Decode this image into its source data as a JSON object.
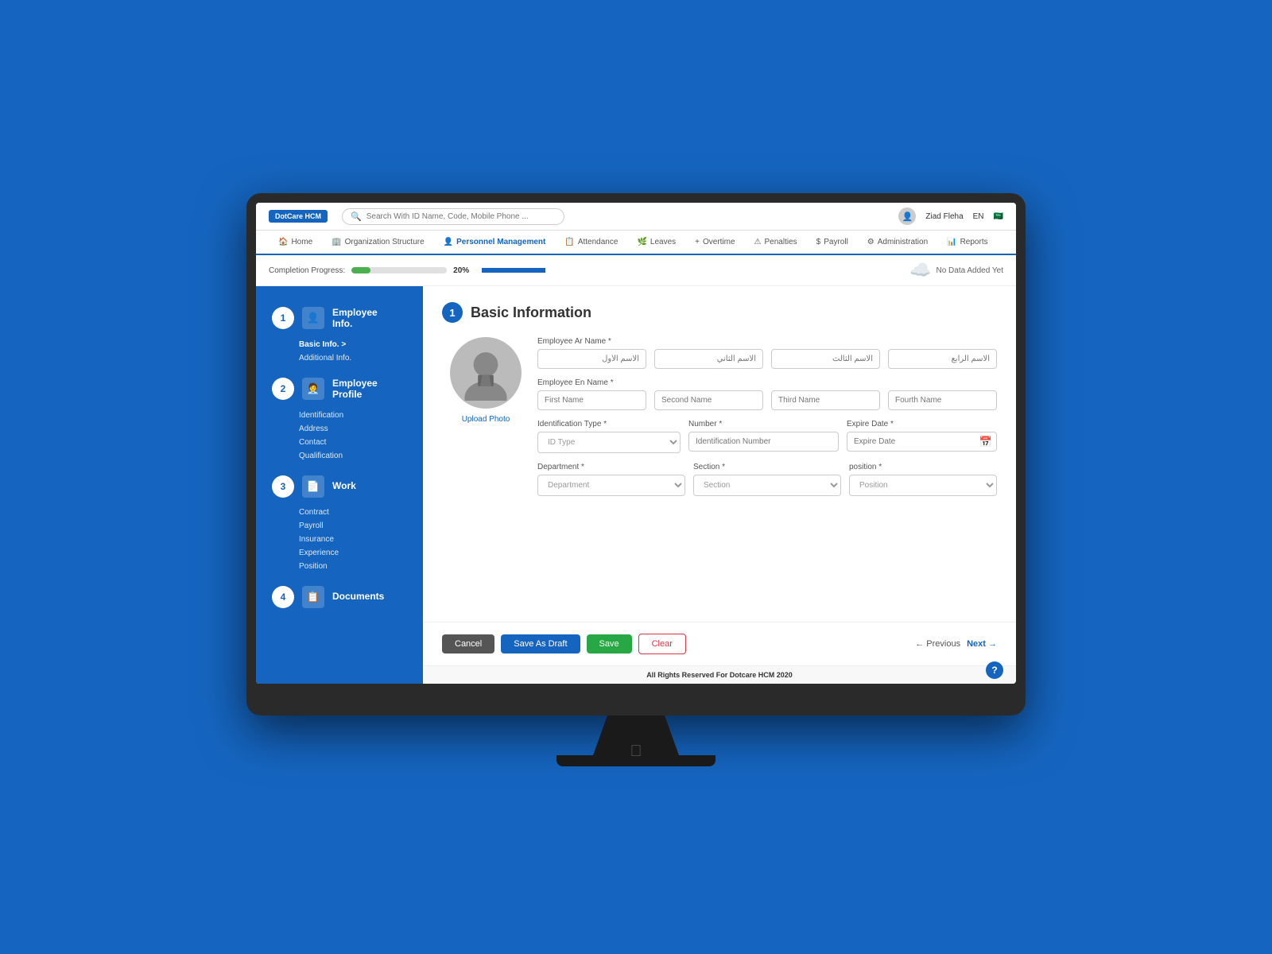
{
  "app": {
    "logo": "DotCare HCM",
    "search_placeholder": "Search With ID Name, Code, Mobile Phone ...",
    "user_name": "Ziad Fleha",
    "lang": "EN",
    "flag": "🇸🇦"
  },
  "nav": {
    "items": [
      {
        "label": "Home",
        "icon": "🏠",
        "active": false
      },
      {
        "label": "Organization Structure",
        "icon": "🏢",
        "active": false
      },
      {
        "label": "Personnel Management",
        "icon": "👤",
        "active": true
      },
      {
        "label": "Attendance",
        "icon": "📋",
        "active": false
      },
      {
        "label": "Leaves",
        "icon": "🌿",
        "active": false
      },
      {
        "label": "Overtime",
        "icon": "+",
        "active": false
      },
      {
        "label": "Penalties",
        "icon": "⚠",
        "active": false
      },
      {
        "label": "Payroll",
        "icon": "$",
        "active": false
      },
      {
        "label": "Administration",
        "icon": "⚙",
        "active": false
      },
      {
        "label": "Reports",
        "icon": "📊",
        "active": false
      }
    ]
  },
  "progress": {
    "label": "Completion Progress:",
    "percent": 20,
    "percent_label": "20",
    "percent_sign": "%",
    "fill_width": "20%"
  },
  "no_data": {
    "text": "No Data Added Yet"
  },
  "sidebar": {
    "sections": [
      {
        "id": "employee-info",
        "step": "1",
        "icon": "👤",
        "title_line1": "Employee",
        "title_line2": "Info.",
        "sub_items": [
          {
            "label": "Basic Info. >",
            "active": true
          },
          {
            "label": "Additional Info."
          }
        ]
      },
      {
        "id": "employee-profile",
        "step": "2",
        "icon": "🧑‍💼",
        "title_line1": "Employee",
        "title_line2": "Profile",
        "sub_items": [
          {
            "label": "Identification"
          },
          {
            "label": "Address"
          },
          {
            "label": "Contact"
          },
          {
            "label": "Qualification"
          }
        ]
      },
      {
        "id": "work",
        "step": "3",
        "icon": "📄",
        "title_line1": "Work",
        "title_line2": "",
        "sub_items": [
          {
            "label": "Contract"
          },
          {
            "label": "Payroll"
          },
          {
            "label": "Insurance"
          },
          {
            "label": "Experience"
          },
          {
            "label": "Position"
          }
        ]
      },
      {
        "id": "documents",
        "step": "4",
        "icon": "📋",
        "title_line1": "Documents",
        "title_line2": "",
        "sub_items": []
      }
    ]
  },
  "form": {
    "section_title": "Basic Information",
    "employee_ar_name_label": "Employee Ar Name *",
    "ar_placeholders": [
      "الاسم الأول",
      "الاسم الثاني",
      "الاسم الثالث",
      "الاسم الرابع"
    ],
    "employee_en_name_label": "Employee En Name *",
    "en_placeholders": [
      "First Name",
      "Second Name",
      "Third Name",
      "Fourth Name"
    ],
    "identification_type_label": "Identification Type *",
    "id_type_placeholder": "ID Type",
    "number_label": "Number *",
    "number_placeholder": "Identification Number",
    "expire_date_label": "Expire Date *",
    "expire_date_placeholder": "Expire Date",
    "department_label": "Department *",
    "department_placeholder": "Department",
    "section_label": "Section *",
    "section_placeholder": "Section",
    "position_label": "position *",
    "position_placeholder": "Position",
    "upload_photo_label": "Upload Photo"
  },
  "actions": {
    "cancel": "Cancel",
    "save_as_draft": "Save As Draft",
    "save": "Save",
    "clear": "Clear",
    "previous": "← Previous",
    "next": "Next →"
  },
  "footer": {
    "text": "All Rights Reserved For",
    "brand": "Dotcare HCM",
    "year": "2020"
  }
}
